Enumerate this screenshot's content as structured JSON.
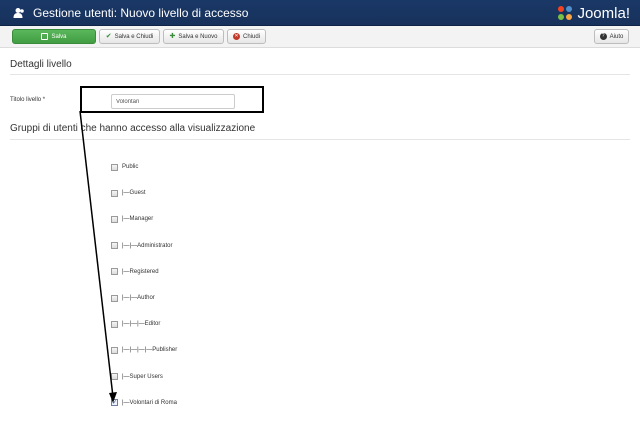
{
  "header": {
    "title": "Gestione utenti: Nuovo livello di accesso",
    "logo_text": "Joomla!"
  },
  "toolbar": {
    "save_label": "Salva",
    "save_close_label": "Salva e Chiudi",
    "save_new_label": "Salva e Nuovo",
    "close_label": "Chiudi",
    "help_label": "Aiuto"
  },
  "details": {
    "section_title": "Dettagli livello",
    "title_label": "Titolo livello *",
    "title_value": "Volontari"
  },
  "groups": {
    "section_title": "Gruppi di utenti che hanno accesso alla visualizzazione",
    "items": [
      {
        "label": "Public",
        "checked": false
      },
      {
        "label": "|—Guest",
        "checked": false
      },
      {
        "label": "|—Manager",
        "checked": false
      },
      {
        "label": "|—|—Administrator",
        "checked": false
      },
      {
        "label": "|—Registered",
        "checked": false
      },
      {
        "label": "|—|—Author",
        "checked": false
      },
      {
        "label": "|—|—|—Editor",
        "checked": false
      },
      {
        "label": "|—|—|—|—Publisher",
        "checked": false
      },
      {
        "label": "|—Super Users",
        "checked": false
      },
      {
        "label": "|—Volontari di Roma",
        "checked": true
      }
    ]
  },
  "colors": {
    "header_bg": "#1a3867",
    "save_green": "#5bb75b"
  }
}
